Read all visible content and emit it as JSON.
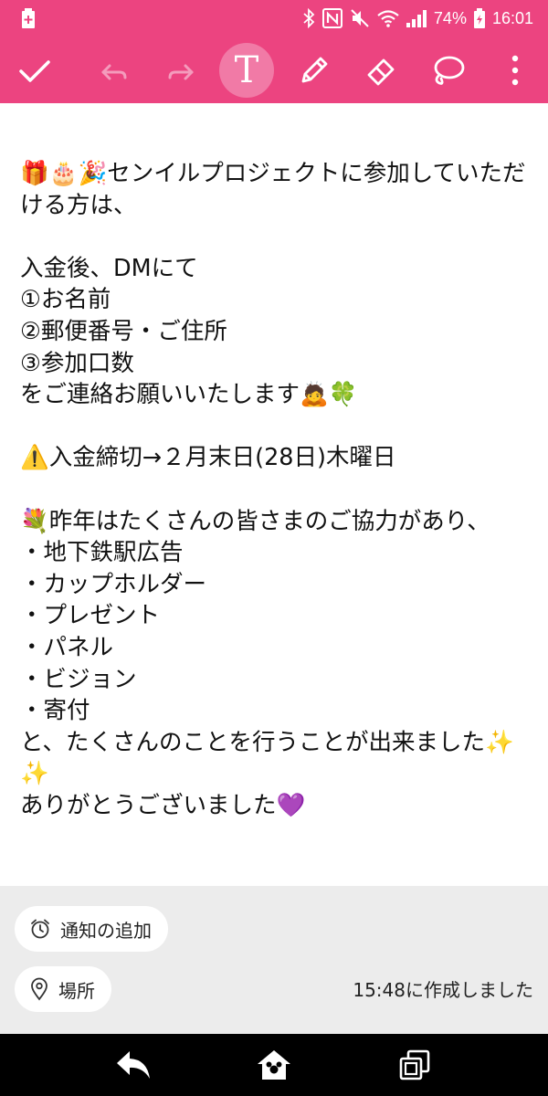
{
  "status_bar": {
    "battery_percent": "74%",
    "time": "16:01",
    "icons": [
      "battery-saver-icon",
      "bluetooth-icon",
      "nfc-icon",
      "mute-icon",
      "wifi-icon",
      "signal-icon",
      "battery-icon"
    ]
  },
  "toolbar": {
    "icons": [
      "check-icon",
      "undo-icon",
      "redo-icon",
      "text-icon",
      "pen-icon",
      "eraser-icon",
      "lasso-icon",
      "more-icon"
    ],
    "text_tool_label": "T",
    "active_tool": "text",
    "accent_color": "#ec4480"
  },
  "note": {
    "text": "🎁🎂🎉センイルプロジェクトに参加していただける方は、\n\n入金後、DMにて\n①お名前\n②郵便番号・ご住所\n③参加口数\nをご連絡お願いいたします🙇🍀\n\n⚠️入金締切→２月末日(28日)木曜日\n\n💐昨年はたくさんの皆さまのご協力があり、\n・地下鉄駅広告\n・カップホルダー\n・プレゼント\n・パネル\n・ビジョン\n・寄付\nと、たくさんのことを行うことが出来ました✨✨\nありがとうございました💜"
  },
  "bottom": {
    "reminder_label": "通知の追加",
    "location_label": "場所",
    "created_text": "15:48に作成しました"
  },
  "nav": {
    "icons": [
      "back-icon",
      "home-icon",
      "recents-icon"
    ]
  }
}
